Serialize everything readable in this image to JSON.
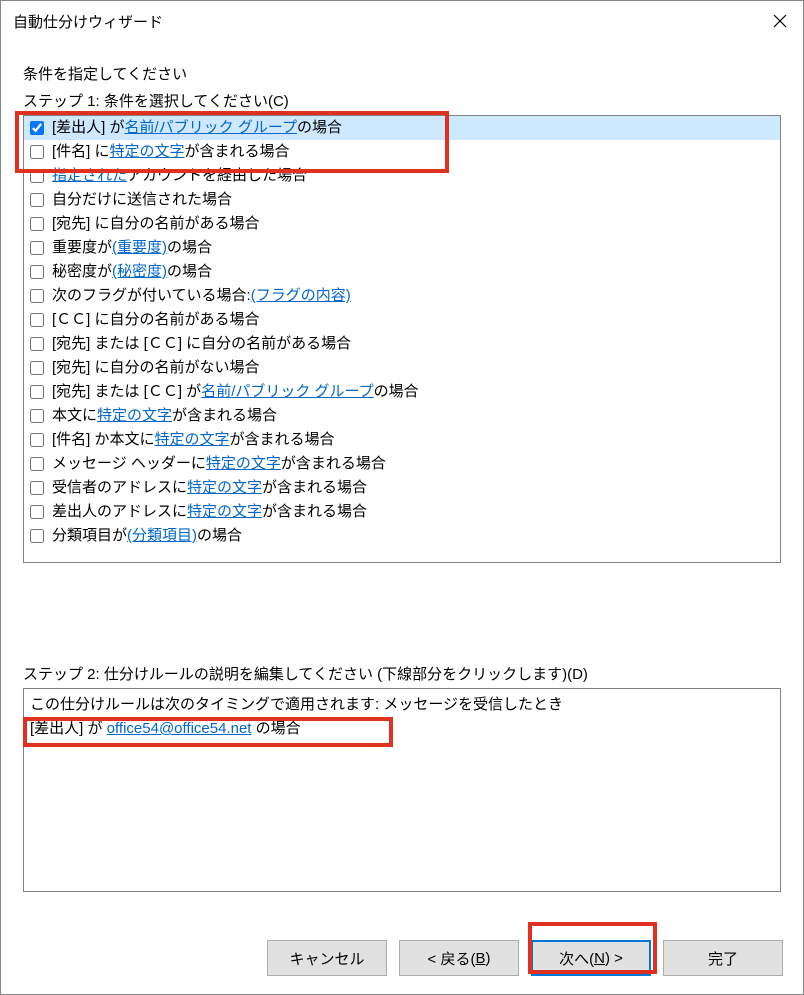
{
  "window": {
    "title": "自動仕分けウィザード"
  },
  "instruction": "条件を指定してください",
  "step1_label": "ステップ 1: 条件を選択してください(C)",
  "conditions": [
    {
      "checked": true,
      "selected": true,
      "parts": [
        {
          "t": "[差出人] が "
        },
        {
          "t": "名前/パブリック グループ",
          "link": true
        },
        {
          "t": " の場合"
        }
      ]
    },
    {
      "checked": false,
      "selected": false,
      "parts": [
        {
          "t": "[件名] に "
        },
        {
          "t": "特定の文字",
          "link": true
        },
        {
          "t": " が含まれる場合"
        }
      ]
    },
    {
      "checked": false,
      "selected": false,
      "parts": [
        {
          "t": "指定された",
          "link": true
        },
        {
          "t": " アカウントを経由した場合"
        }
      ]
    },
    {
      "checked": false,
      "selected": false,
      "parts": [
        {
          "t": "自分だけに送信された場合"
        }
      ]
    },
    {
      "checked": false,
      "selected": false,
      "parts": [
        {
          "t": "[宛先] に自分の名前がある場合"
        }
      ]
    },
    {
      "checked": false,
      "selected": false,
      "parts": [
        {
          "t": "重要度が "
        },
        {
          "t": "(重要度)",
          "link": true
        },
        {
          "t": " の場合"
        }
      ]
    },
    {
      "checked": false,
      "selected": false,
      "parts": [
        {
          "t": "秘密度が "
        },
        {
          "t": "(秘密度)",
          "link": true
        },
        {
          "t": " の場合"
        }
      ]
    },
    {
      "checked": false,
      "selected": false,
      "parts": [
        {
          "t": "次のフラグが付いている場合: "
        },
        {
          "t": "(フラグの内容)",
          "link": true
        }
      ]
    },
    {
      "checked": false,
      "selected": false,
      "parts": [
        {
          "t": "[ＣＣ] に自分の名前がある場合"
        }
      ]
    },
    {
      "checked": false,
      "selected": false,
      "parts": [
        {
          "t": "[宛先] または [ＣＣ] に自分の名前がある場合"
        }
      ]
    },
    {
      "checked": false,
      "selected": false,
      "parts": [
        {
          "t": "[宛先] に自分の名前がない場合"
        }
      ]
    },
    {
      "checked": false,
      "selected": false,
      "parts": [
        {
          "t": "[宛先] または [ＣＣ] が "
        },
        {
          "t": "名前/パブリック グループ",
          "link": true
        },
        {
          "t": " の場合"
        }
      ]
    },
    {
      "checked": false,
      "selected": false,
      "parts": [
        {
          "t": "本文に "
        },
        {
          "t": "特定の文字",
          "link": true
        },
        {
          "t": " が含まれる場合"
        }
      ]
    },
    {
      "checked": false,
      "selected": false,
      "parts": [
        {
          "t": "[件名] か本文に "
        },
        {
          "t": "特定の文字",
          "link": true
        },
        {
          "t": " が含まれる場合"
        }
      ]
    },
    {
      "checked": false,
      "selected": false,
      "parts": [
        {
          "t": "メッセージ ヘッダーに "
        },
        {
          "t": "特定の文字",
          "link": true
        },
        {
          "t": " が含まれる場合"
        }
      ]
    },
    {
      "checked": false,
      "selected": false,
      "parts": [
        {
          "t": "受信者のアドレスに "
        },
        {
          "t": "特定の文字",
          "link": true
        },
        {
          "t": " が含まれる場合"
        }
      ]
    },
    {
      "checked": false,
      "selected": false,
      "parts": [
        {
          "t": "差出人のアドレスに "
        },
        {
          "t": "特定の文字",
          "link": true
        },
        {
          "t": " が含まれる場合"
        }
      ]
    },
    {
      "checked": false,
      "selected": false,
      "parts": [
        {
          "t": "分類項目が "
        },
        {
          "t": "(分類項目)",
          "link": true
        },
        {
          "t": " の場合"
        }
      ]
    }
  ],
  "step2_label": "ステップ 2: 仕分けルールの説明を編集してください (下線部分をクリックします)(D)",
  "description": {
    "line1": "この仕分けルールは次のタイミングで適用されます: メッセージを受信したとき",
    "line2_prefix": "[差出人] が ",
    "line2_link": "office54@office54.net",
    "line2_suffix": " の場合"
  },
  "buttons": {
    "cancel": "キャンセル",
    "back_prefix": "< 戻る(",
    "back_accel": "B",
    "back_suffix": ")",
    "next_prefix": "次へ(",
    "next_accel": "N",
    "next_suffix": ") >",
    "finish": "完了"
  }
}
